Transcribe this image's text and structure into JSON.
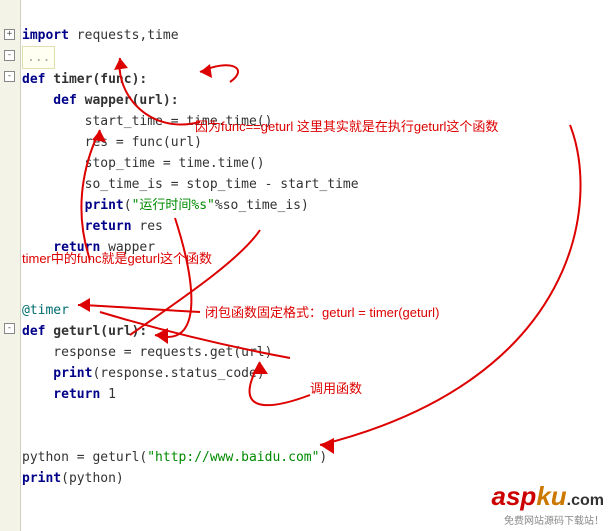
{
  "code": {
    "l1": "import",
    "l1b": " requests,time",
    "l2": "...",
    "l3a": "def",
    "l3b": " timer(func):",
    "l4a": "    def",
    "l4b": " wapper(url):",
    "l5": "        start_time = time.time()",
    "l6": "        res = func(url)",
    "l7": "        stop_time = time.time()",
    "l8": "        so_time_is = stop_time - start_time",
    "l9a": "        print",
    "l9b": "(",
    "l9c": "\"运行时间%s\"",
    "l9d": "%so_time_is)",
    "l10a": "        return",
    "l10b": " res",
    "l11a": "    return",
    "l11b": " wapper",
    "l13a": "@timer",
    "l14a": "def",
    "l14b": " geturl(url):",
    "l15": "    response = requests.get(url)",
    "l16a": "    print",
    "l16b": "(response.status_code)",
    "l17a": "    return",
    "l17b": " 1",
    "l19": "python = geturl(",
    "l19b": "\"http://www.baidu.com\"",
    "l19c": ")",
    "l20a": "print",
    "l20b": "(python)"
  },
  "annotations": {
    "a1": "因为func==geturl 这里其实就是在执行geturl这个函数",
    "a2": "timer中的func就是geturl这个函数",
    "a3": "闭包函数固定格式：geturl = timer(geturl)",
    "a4": "调用函数"
  },
  "watermark": {
    "main1": "asp",
    "main2": "ku",
    "main3": ".com",
    "sub": "免费网站源码下载站！"
  }
}
